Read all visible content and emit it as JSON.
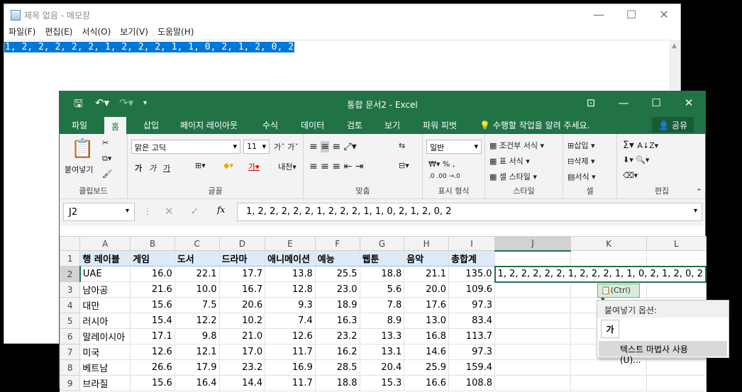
{
  "notepad": {
    "title": "제목 없음 - 메모장",
    "menu": [
      "파일(F)",
      "편집(E)",
      "서식(O)",
      "보기(V)",
      "도움말(H)"
    ],
    "content": "1, 2, 2, 2, 2, 2, 1, 2, 2, 2, 1, 1, 0, 2, 1, 2, 0, 2",
    "icon": "notepad-icon",
    "controls": [
      "—",
      "☐",
      "✕"
    ]
  },
  "excel": {
    "title": "통합 문서2 - Excel",
    "tabs": [
      "파일",
      "홈",
      "삽입",
      "페이지 레이아웃",
      "수식",
      "데이터",
      "검토",
      "보기",
      "파워 피벗"
    ],
    "tell_me": "수행할 작업을 알려 주세요.",
    "share": "공유",
    "ribbon": {
      "clipboard": {
        "label": "클립보드",
        "paste": "붙여넣기"
      },
      "font": {
        "label": "글꼴",
        "name": "맑은 고딕",
        "size": "11",
        "bold": "가",
        "italic": "가",
        "underline": "가"
      },
      "align": {
        "label": "맞춤"
      },
      "number": {
        "label": "표시 형식",
        "format": "일반",
        "percent": "%"
      },
      "styles": {
        "label": "스타일",
        "cond": "조건부 서식",
        "table": "표 서식",
        "cell": "셀 스타일"
      },
      "cells": {
        "label": "셀",
        "insert": "삽입",
        "delete": "삭제",
        "format": "서식"
      },
      "edit": {
        "label": "편집"
      }
    },
    "namebox": "J2",
    "formula": "1, 2, 2, 2, 2, 2, 1, 2, 2, 2, 1, 1, 0, 2, 1, 2, 0, 2",
    "columns": [
      "A",
      "B",
      "C",
      "D",
      "E",
      "F",
      "G",
      "H",
      "I",
      "J",
      "K",
      "L"
    ],
    "header_row": [
      "행 레이블",
      "게임",
      "도서",
      "드라마",
      "애니메이션",
      "예능",
      "웹툰",
      "음악",
      "총합계"
    ],
    "rows": [
      {
        "n": "2",
        "cells": [
          "UAE",
          "16.0",
          "22.1",
          "17.7",
          "13.8",
          "25.5",
          "18.8",
          "21.1",
          "135.0"
        ]
      },
      {
        "n": "3",
        "cells": [
          "남아공",
          "21.6",
          "10.0",
          "16.7",
          "12.8",
          "23.0",
          "5.6",
          "20.0",
          "109.6"
        ]
      },
      {
        "n": "4",
        "cells": [
          "대만",
          "15.6",
          "7.5",
          "20.6",
          "9.3",
          "18.9",
          "7.8",
          "17.6",
          "97.3"
        ]
      },
      {
        "n": "5",
        "cells": [
          "러시아",
          "15.4",
          "12.2",
          "10.2",
          "7.4",
          "16.3",
          "8.9",
          "13.0",
          "83.4"
        ]
      },
      {
        "n": "6",
        "cells": [
          "말레이시아",
          "17.1",
          "9.8",
          "21.0",
          "12.6",
          "23.2",
          "13.3",
          "16.8",
          "113.7"
        ]
      },
      {
        "n": "7",
        "cells": [
          "미국",
          "12.6",
          "12.1",
          "17.0",
          "11.7",
          "16.2",
          "13.1",
          "14.6",
          "97.3"
        ]
      },
      {
        "n": "8",
        "cells": [
          "베트남",
          "26.6",
          "17.9",
          "23.2",
          "16.9",
          "28.5",
          "20.4",
          "25.9",
          "159.4"
        ]
      },
      {
        "n": "9",
        "cells": [
          "브라질",
          "15.6",
          "16.4",
          "14.4",
          "11.7",
          "18.8",
          "15.3",
          "16.6",
          "108.8"
        ]
      }
    ],
    "j2_value": "1, 2, 2, 2, 2, 2, 1, 2, 2, 2, 1, 1, 0, 2, 1, 2, 0, 2",
    "paste_tag": "(Ctrl) ▾",
    "paste_menu": {
      "header": "붙여넣기 옵션:",
      "keep": "가",
      "wizard": "텍스트 마법사 사용(U)..."
    }
  }
}
